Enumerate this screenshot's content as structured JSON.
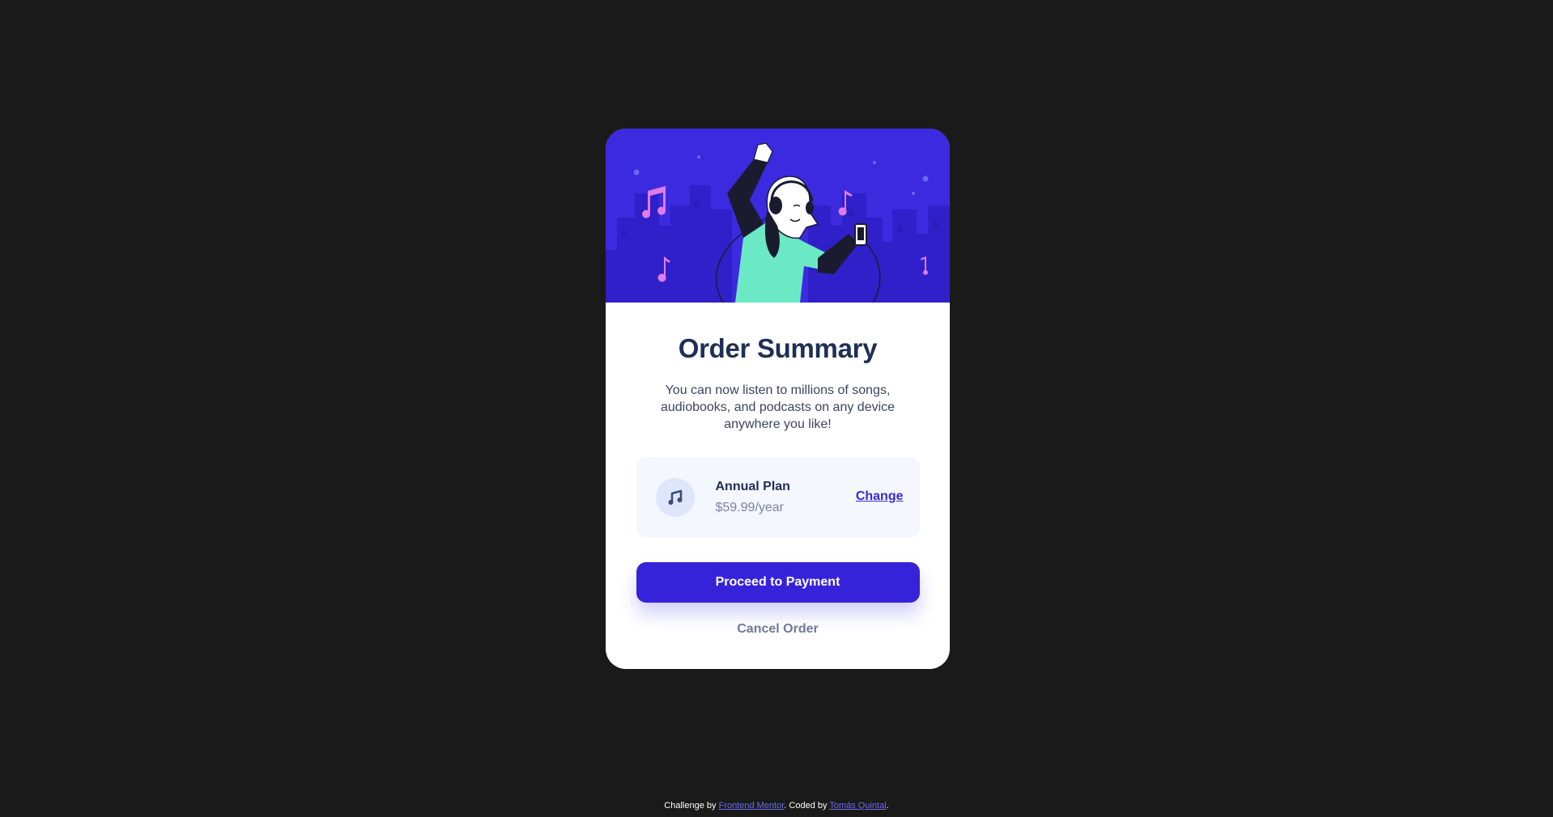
{
  "card": {
    "title": "Order Summary",
    "description": "You can now listen to millions of songs, audiobooks, and podcasts on any device anywhere you like!"
  },
  "plan": {
    "icon": "music-note-icon",
    "name": "Annual Plan",
    "price": "$59.99/year",
    "change_label": "Change"
  },
  "actions": {
    "proceed_label": "Proceed to Payment",
    "cancel_label": "Cancel Order"
  },
  "attribution": {
    "prefix": "Challenge by ",
    "challenge_link": "Frontend Mentor",
    "middle": ". Coded by ",
    "author_link": "Tomás Quintal",
    "suffix": "."
  },
  "colors": {
    "background": "#1a1a1a",
    "hero": "#3c2ae0",
    "primary": "#3623d9",
    "title": "#1f2f56",
    "plan_bg": "#f5f7ff"
  }
}
